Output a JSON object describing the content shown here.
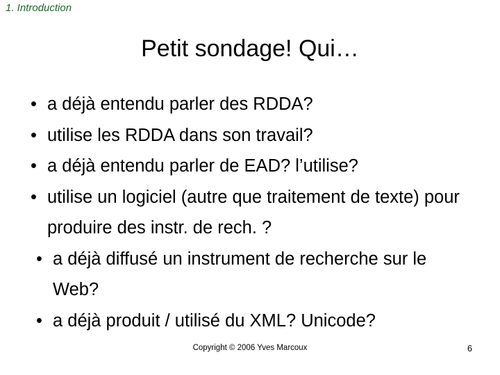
{
  "slide": {
    "section_header": "1. Introduction",
    "title": "Petit sondage! Qui…",
    "bullet_glyph": "•",
    "bullets": [
      {
        "text": "a déjà entendu parler des RDDA?",
        "indented": false
      },
      {
        "text": "utilise les RDDA dans son travail?",
        "indented": false
      },
      {
        "text": "a déjà entendu parler de EAD? l’utilise?",
        "indented": false
      },
      {
        "text": "utilise un logiciel (autre que traitement de texte) pour produire des instr. de rech. ?",
        "indented": false
      },
      {
        "text": "a déjà diffusé un instrument de recherche sur le Web?",
        "indented": true
      },
      {
        "text": "a déjà produit / utilisé du XML? Unicode?",
        "indented": true
      }
    ],
    "footer": {
      "copyright": "Copyright © 2006 Yves Marcoux",
      "page_number": "6"
    },
    "colors": {
      "header_green": "#1a6b2a",
      "text_black": "#000000",
      "background": "#ffffff"
    }
  }
}
